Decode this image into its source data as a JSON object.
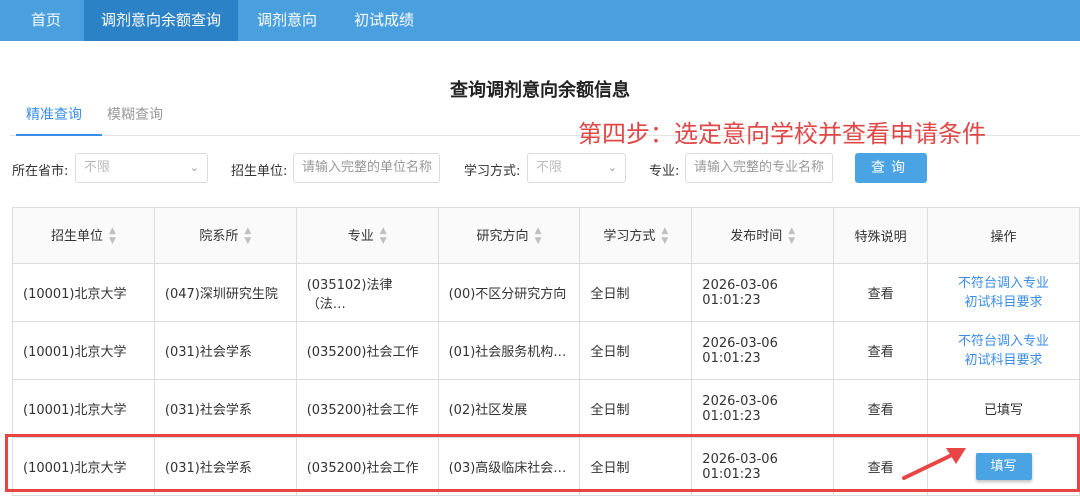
{
  "nav": {
    "items": [
      {
        "label": "首页"
      },
      {
        "label": "调剂意向余额查询"
      },
      {
        "label": "调剂意向"
      },
      {
        "label": "初试成绩"
      }
    ]
  },
  "page": {
    "title": "查询调剂意向余额信息"
  },
  "tabs": [
    {
      "label": "精准查询"
    },
    {
      "label": "模糊查询"
    }
  ],
  "annotation": {
    "text": "第四步：选定意向学校并查看申请条件"
  },
  "filters": {
    "province_label": "所在省市:",
    "province_value": "不限",
    "unit_label": "招生单位:",
    "unit_placeholder": "请输入完整的单位名称",
    "mode_label": "学习方式:",
    "mode_value": "不限",
    "major_label": "专业:",
    "major_placeholder": "请输入完整的专业名称",
    "search_label": "查询"
  },
  "table": {
    "headers": [
      "招生单位",
      "院系所",
      "专业",
      "研究方向",
      "学习方式",
      "发布时间",
      "特殊说明",
      "操作"
    ],
    "rows": [
      {
        "unit": "(10001)北京大学",
        "dept": "(047)深圳研究生院",
        "major": "(035102)法律（法…",
        "direction": "(00)不区分研究方向",
        "mode": "全日制",
        "date": "2026-03-06",
        "time": "01:01:23",
        "note": "查看",
        "action_line1": "不符台调入专业",
        "action_line2": "初试科目要求"
      },
      {
        "unit": "(10001)北京大学",
        "dept": "(031)社会学系",
        "major": "(035200)社会工作",
        "direction": "(01)社会服务机构…",
        "mode": "全日制",
        "date": "2026-03-06",
        "time": "01:01:23",
        "note": "查看",
        "action_line1": "不符台调入专业",
        "action_line2": "初试科目要求"
      },
      {
        "unit": "(10001)北京大学",
        "dept": "(031)社会学系",
        "major": "(035200)社会工作",
        "direction": "(02)社区发展",
        "mode": "全日制",
        "date": "2026-03-06",
        "time": "01:01:23",
        "note": "查看",
        "action": "已填写"
      },
      {
        "unit": "(10001)北京大学",
        "dept": "(031)社会学系",
        "major": "(035200)社会工作",
        "direction": "(03)高级临床社会…",
        "mode": "全日制",
        "date": "2026-03-06",
        "time": "01:01:23",
        "note": "查看",
        "action": "填写"
      }
    ]
  },
  "colors": {
    "nav_bg": "#4a9fde",
    "nav_active": "#2c82c7",
    "link": "#3a8ee6",
    "button": "#4aa3e3",
    "annotation": "#e04848"
  }
}
